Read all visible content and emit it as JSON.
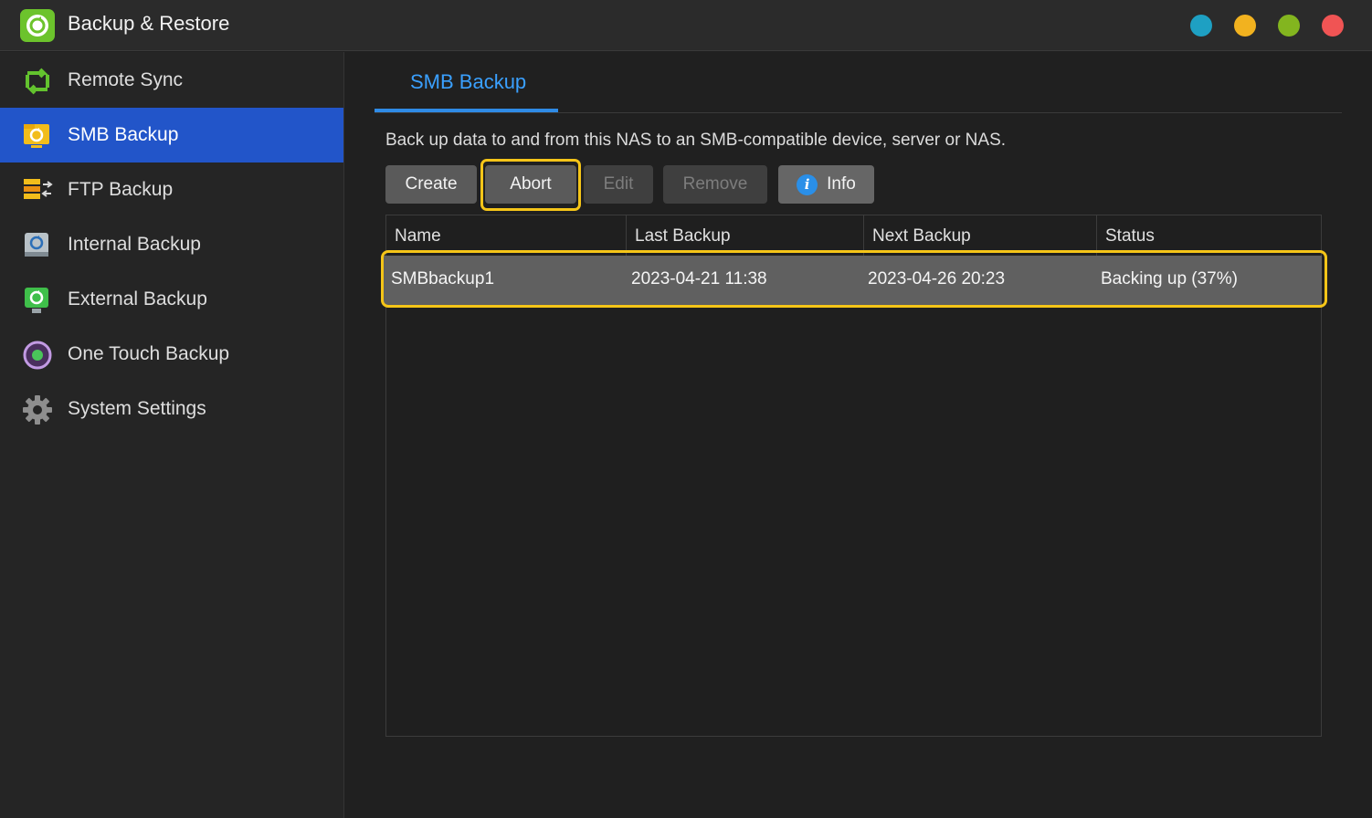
{
  "app": {
    "title": "Backup & Restore",
    "window_controls": [
      {
        "name": "window-dot-teal",
        "color": "#1ea0c3"
      },
      {
        "name": "window-dot-yellow",
        "color": "#f2b21f"
      },
      {
        "name": "window-dot-green",
        "color": "#83b51f"
      },
      {
        "name": "window-dot-red",
        "color": "#f05454"
      }
    ]
  },
  "sidebar": {
    "items": [
      {
        "label": "Remote Sync",
        "icon": "remote-sync-icon",
        "active": false
      },
      {
        "label": "SMB Backup",
        "icon": "smb-backup-icon",
        "active": true
      },
      {
        "label": "FTP Backup",
        "icon": "ftp-backup-icon",
        "active": false
      },
      {
        "label": "Internal Backup",
        "icon": "internal-backup-icon",
        "active": false
      },
      {
        "label": "External Backup",
        "icon": "external-backup-icon",
        "active": false
      },
      {
        "label": "One Touch Backup",
        "icon": "one-touch-backup-icon",
        "active": false
      },
      {
        "label": "System Settings",
        "icon": "gear-icon",
        "active": false
      }
    ]
  },
  "main": {
    "tab": "SMB Backup",
    "description": "Back up data to and from this NAS to an SMB-compatible device, server or NAS.",
    "toolbar": {
      "create": "Create",
      "abort": "Abort",
      "edit": "Edit",
      "remove": "Remove",
      "info": "Info"
    },
    "table": {
      "headers": [
        "Name",
        "Last Backup",
        "Next Backup",
        "Status"
      ],
      "rows": [
        {
          "name": "SMBbackup1",
          "last_backup": "2023-04-21 11:38",
          "next_backup": "2023-04-26 20:23",
          "status": "Backing up (37%)"
        }
      ]
    }
  }
}
